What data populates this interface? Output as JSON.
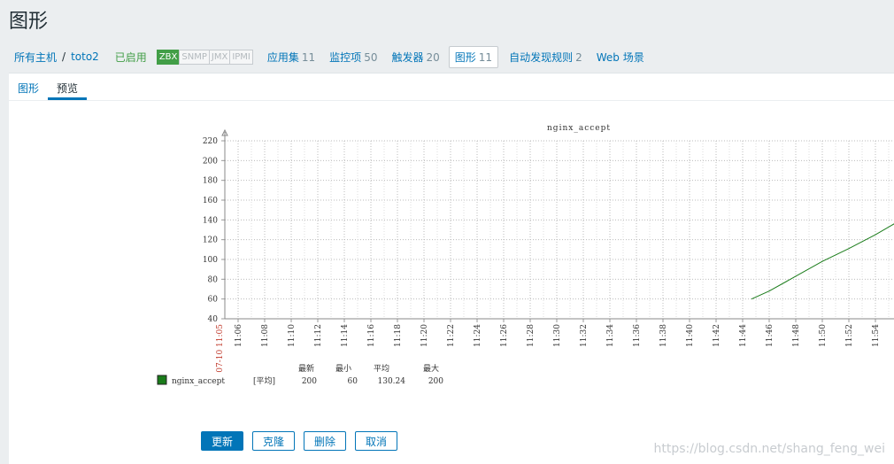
{
  "page": {
    "title": "图形"
  },
  "breadcrumb": {
    "all_hosts": "所有主机",
    "separator": "/",
    "host": "toto2",
    "status": "已启用",
    "protocols": [
      "ZBX",
      "SNMP",
      "JMX",
      "IPMI"
    ],
    "links": [
      {
        "label": "应用集",
        "count": "11"
      },
      {
        "label": "监控项",
        "count": "50"
      },
      {
        "label": "触发器",
        "count": "20"
      },
      {
        "label": "图形",
        "count": "11"
      },
      {
        "label": "自动发现规则",
        "count": "2"
      },
      {
        "label": "Web 场景",
        "count": ""
      }
    ]
  },
  "tabs": [
    "图形",
    "预览"
  ],
  "active_tab": "预览",
  "legend_table": {
    "headers": [
      "最新",
      "最小",
      "平均",
      "最大"
    ],
    "rows": [
      {
        "name": "nginx_accept",
        "func": "[平均]",
        "last": "200",
        "min": "60",
        "avg": "130.24",
        "max": "200",
        "color": "#1a7c1a"
      }
    ]
  },
  "chart_data": {
    "type": "line",
    "title": "nginx_accept",
    "ylim": [
      40,
      220
    ],
    "yticks": [
      "40",
      "60",
      "80",
      "100",
      "120",
      "140",
      "160",
      "180",
      "200",
      "220"
    ],
    "xtick_labels": [
      "11:06",
      "11:08",
      "11:10",
      "11:12",
      "11:14",
      "11:16",
      "11:18",
      "11:20",
      "11:22",
      "11:24",
      "11:26",
      "11:28",
      "11:30",
      "11:32",
      "11:34",
      "11:36",
      "11:38",
      "11:40",
      "11:42",
      "11:44",
      "11:46",
      "11:48",
      "11:50",
      "11:52",
      "11:54"
    ],
    "start_label": "07-10 11:05",
    "grid": true,
    "series": [
      {
        "name": "nginx_accept",
        "color": "#1a7c1a",
        "x": [
          "11:44:40",
          "11:46",
          "11:48",
          "11:50",
          "11:52",
          "11:54",
          "11:55:40"
        ],
        "values": [
          60,
          68,
          83,
          98,
          111,
          125,
          138
        ]
      }
    ]
  },
  "buttons": {
    "update": "更新",
    "clone": "克隆",
    "delete": "删除",
    "cancel": "取消"
  },
  "watermark": "https://blog.csdn.net/shang_feng_wei"
}
